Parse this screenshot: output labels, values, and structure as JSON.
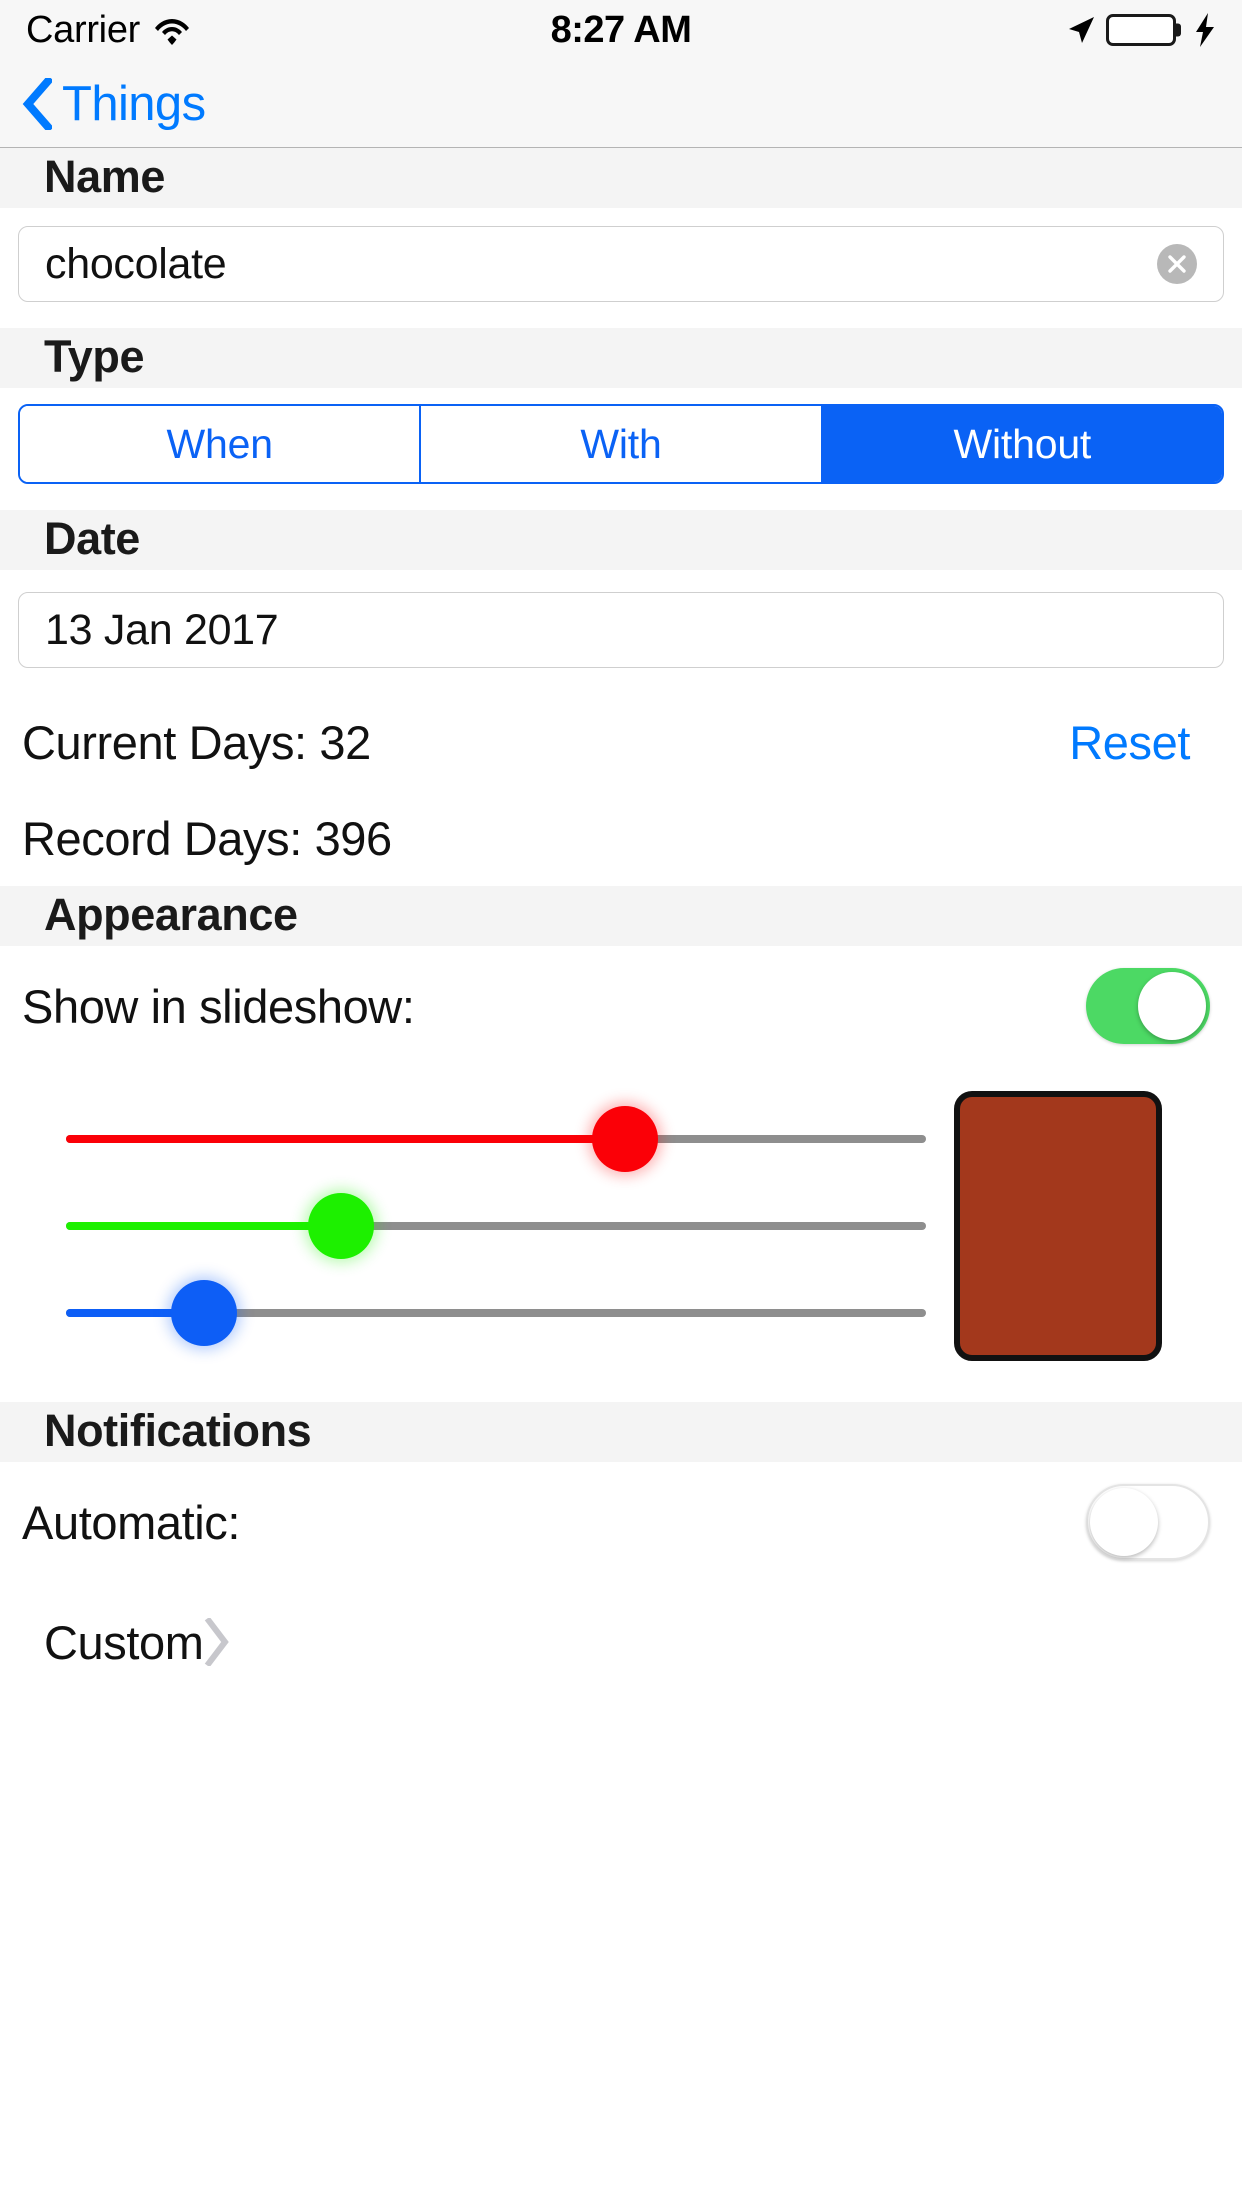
{
  "status_bar": {
    "carrier": "Carrier",
    "time": "8:27 AM",
    "wifi_icon": "wifi-icon",
    "location_icon": "location-arrow-icon",
    "battery_icon": "battery-icon",
    "battery_charging_icon": "lightning-bolt-icon",
    "battery_color": "#4cd964"
  },
  "nav": {
    "back_label": "Things",
    "back_icon": "chevron-left-icon",
    "tint_color": "#007aff"
  },
  "sections": {
    "name": {
      "header": "Name",
      "value": "chocolate",
      "clear_icon": "clear-circle-icon"
    },
    "type": {
      "header": "Type",
      "options": [
        "When",
        "With",
        "Without"
      ],
      "selected": "Without",
      "accent_color": "#0a62f5"
    },
    "date": {
      "header": "Date",
      "value": "13 Jan 2017",
      "current_days_label": "Current Days: 32",
      "reset_label": "Reset",
      "record_days_label": "Record Days: 396"
    },
    "appearance": {
      "header": "Appearance",
      "slideshow_label": "Show in slideshow:",
      "slideshow_on": true,
      "sliders": [
        {
          "name": "red",
          "value": 65,
          "color": "#fb0007"
        },
        {
          "name": "green",
          "value": 32,
          "color": "#1df000"
        },
        {
          "name": "blue",
          "value": 16,
          "color": "#0d5ef6"
        }
      ],
      "preview_color": "#a3381c"
    },
    "notifications": {
      "header": "Notifications",
      "automatic_label": "Automatic:",
      "automatic_on": false,
      "custom_label": "Custom",
      "custom_chevron_icon": "chevron-right-icon"
    }
  }
}
